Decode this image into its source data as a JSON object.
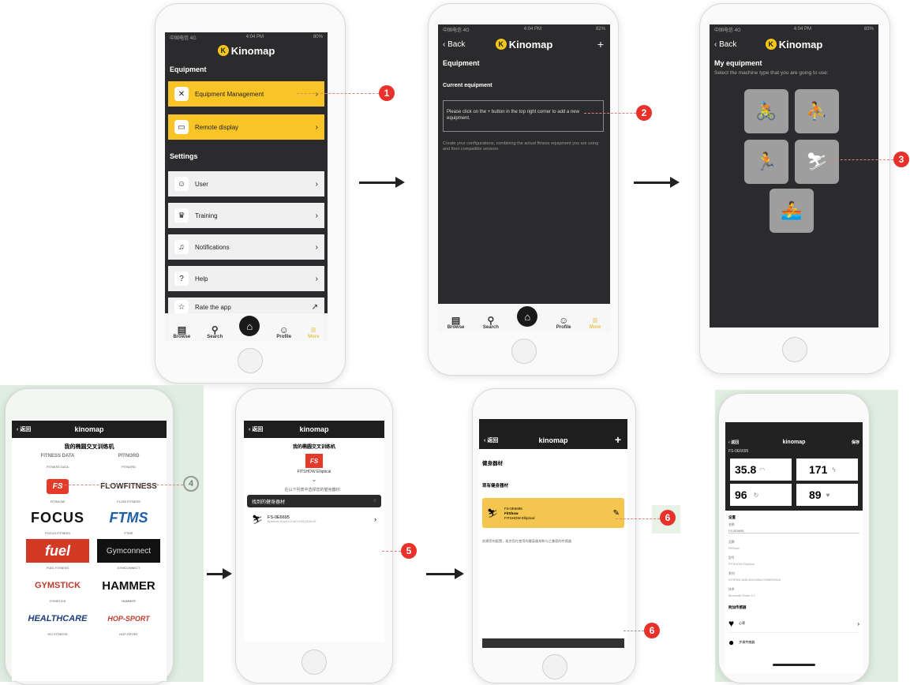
{
  "colors": {
    "accent": "#f9c526",
    "callout": "#e8312a",
    "screen_bg": "#2b2b2d"
  },
  "phone1": {
    "status_carrier": "中国电信 4G",
    "status_time": "4:04 PM",
    "status_battery": "80%",
    "app_name": "Kinomap",
    "equipment_section": "Equipment",
    "equipment_items": [
      {
        "label": "Equipment Management",
        "icon": "tools-icon"
      },
      {
        "label": "Remote display",
        "icon": "monitor-icon"
      }
    ],
    "settings_section": "Settings",
    "settings_items": [
      {
        "label": "User",
        "icon": "user-icon"
      },
      {
        "label": "Training",
        "icon": "trophy-icon"
      },
      {
        "label": "Notifications",
        "icon": "bell-icon"
      },
      {
        "label": "Help",
        "icon": "help-icon"
      },
      {
        "label": "Rate the app",
        "icon": "star-icon"
      }
    ],
    "tabs": {
      "browse": "Browse",
      "search": "Search",
      "profile": "Profile",
      "more": "More"
    }
  },
  "phone2": {
    "status_carrier": "中国电信 4G",
    "status_time": "4:04 PM",
    "status_battery": "82%",
    "back": "Back",
    "app_name": "Kinomap",
    "plus": "+",
    "title": "Equipment",
    "current": "Current equipment",
    "hint": "Please click on the + button in the top right corner to add a new equipment.",
    "desc": "Create your configurations, combining the actual fitness equipment you are using and their compatible sensors",
    "tabs": {
      "browse": "Browse",
      "search": "Search",
      "profile": "Profile",
      "more": "More"
    }
  },
  "phone3": {
    "status_carrier": "中国电信 4G",
    "status_time": "4:04 PM",
    "status_battery": "83%",
    "back": "Back",
    "app_name": "Kinomap",
    "title": "My equipment",
    "subtitle": "Select the machine type that you are going to use:"
  },
  "phone4": {
    "back": "返回",
    "app_name": "kinomap",
    "title": "我的椭圆交叉训练机",
    "brands": [
      {
        "name": "FITNESS DATA",
        "cap": "FITNESS DATA"
      },
      {
        "name": "PITNORD",
        "cap": "PITNORD"
      },
      {
        "name": "FS",
        "cap": "FITSHOW"
      },
      {
        "name": "FLOWFITNESS",
        "cap": "FLOW FITNESS"
      },
      {
        "name": "FOCUS",
        "cap": "FOCUS FITNESS"
      },
      {
        "name": "FTMS",
        "cap": "FTMS"
      },
      {
        "name": "fuel",
        "cap": "FUEL FITNESS"
      },
      {
        "name": "Gymconnect",
        "cap": "GYMCONNECT"
      },
      {
        "name": "GYMSTICK",
        "cap": "GYMSTICK"
      },
      {
        "name": "HAMMER",
        "cap": "HAMMER"
      },
      {
        "name": "HEALTHCARE",
        "cap": "HCI FITNESS"
      },
      {
        "name": "HOP-SPORT",
        "cap": "HOP-SPORT"
      }
    ]
  },
  "phone5": {
    "back": "返回",
    "app_name": "kinomap",
    "title": "我的椭圆交叉训练机",
    "brand": "FITSHOW Elliptical",
    "scan_text": "在以下列表中选择您的健身器材：",
    "found": "找到的健身器材",
    "device": "FS-0E6695",
    "device_sub": "Bluetooth Smart 4.0 A8:19:D6:23:5A:0E"
  },
  "phone6": {
    "back": "返回",
    "app_name": "kinomap",
    "plus": "+",
    "title": "健身器材",
    "current": "现有健身器材",
    "device": "FS-0E6695",
    "dev_brand": "FitShow",
    "dev_type": "FITSHOW Elliptical",
    "desc": "创建您的配置，组合您在使用的健身器材和与之兼容的传感器"
  },
  "phone7": {
    "back": "返回",
    "app_name": "kinomap",
    "save": "保存",
    "device": "FS-0E6695",
    "metrics": [
      {
        "value": "35.8"
      },
      {
        "value": "171"
      },
      {
        "value": "96"
      },
      {
        "value": "89"
      }
    ],
    "settings": "设置",
    "name_label": "名称",
    "name_value": "FS-0E6695",
    "brand_label": "品牌",
    "brand_value": "FitShow",
    "model_label": "型号",
    "model_value": "FITSHOW Elliptical",
    "serial_label": "系列",
    "serial_value": "E2F5F9DE-8A69-4EEA-9B6A-F9298B79D0AE",
    "tech_label": "技术",
    "tech_value": "Bluetooth Smart 4.0",
    "sensors": "附加传感器",
    "sensor1": "心率",
    "sensor2": "步调传感器"
  },
  "callouts": [
    "1",
    "2",
    "3",
    "4",
    "5",
    "6",
    "6"
  ]
}
